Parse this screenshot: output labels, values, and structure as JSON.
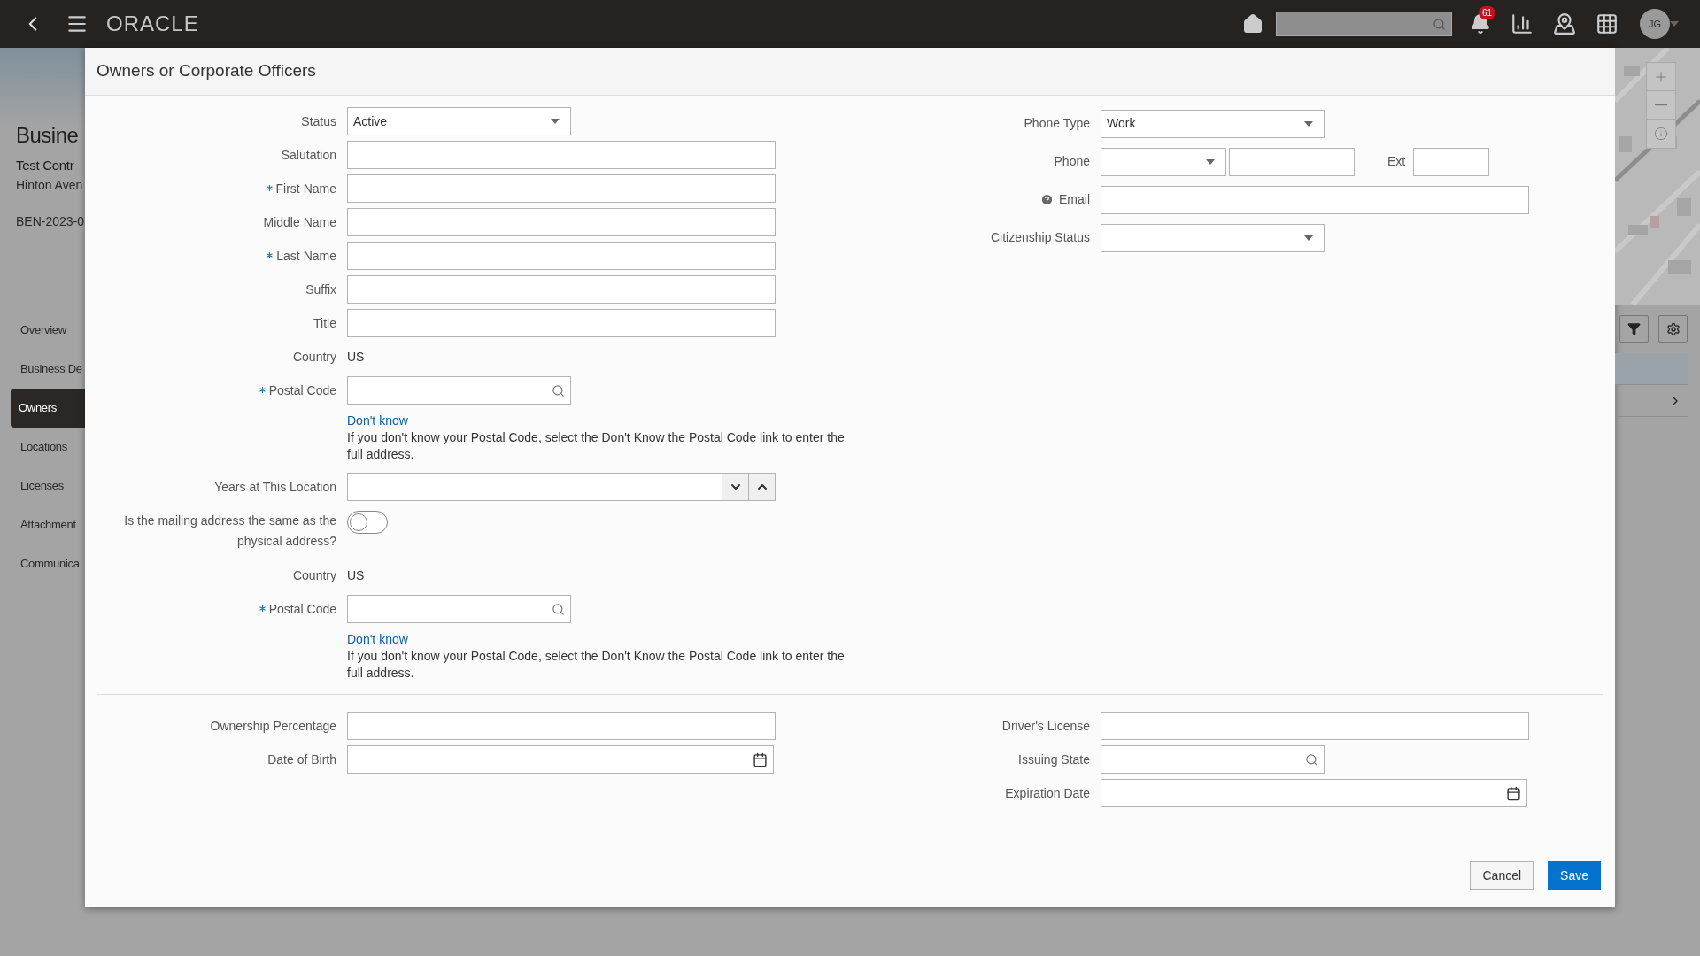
{
  "top_bar": {
    "brand": "ORACLE",
    "notification_count": "61",
    "avatar_initials": "JG"
  },
  "background": {
    "page_title": "Busine",
    "record_name": "Test Contr",
    "address": "Hinton Aven",
    "record_id": "BEN-2023-0",
    "nav_items": [
      {
        "label": "Overview",
        "selected": false
      },
      {
        "label": "Business De",
        "selected": false
      },
      {
        "label": "Owners",
        "selected": true
      },
      {
        "label": "Locations",
        "selected": false
      },
      {
        "label": "Licenses",
        "selected": false
      },
      {
        "label": "Attachment",
        "selected": false
      },
      {
        "label": "Communica",
        "selected": false
      }
    ]
  },
  "dialog": {
    "title": "Owners or Corporate Officers",
    "left_fields": [
      {
        "kind": "select",
        "label": "Status",
        "required": false,
        "value": "Active"
      },
      {
        "kind": "text",
        "label": "Salutation",
        "required": false
      },
      {
        "kind": "text",
        "label": "First Name",
        "required": true
      },
      {
        "kind": "text",
        "label": "Middle Name",
        "required": false
      },
      {
        "kind": "text",
        "label": "Last Name",
        "required": true
      },
      {
        "kind": "text",
        "label": "Suffix",
        "required": false
      },
      {
        "kind": "text",
        "label": "Title",
        "required": false
      },
      {
        "kind": "readonly",
        "label": "Country",
        "required": false,
        "value": "US"
      },
      {
        "kind": "lookup",
        "label": "Postal Code",
        "required": true
      },
      {
        "kind": "help",
        "link": "Don't know",
        "text": "If you don't know your Postal Code, select the Don't Know the Postal Code link to enter the full address."
      },
      {
        "kind": "spinner",
        "label": "Years at This Location",
        "required": false
      },
      {
        "kind": "toggle",
        "label": "Is the mailing address the same as the physical address?",
        "required": false,
        "on": false
      },
      {
        "kind": "readonly",
        "label": "Country",
        "required": false,
        "value": "US"
      },
      {
        "kind": "lookup",
        "label": "Postal Code",
        "required": true
      },
      {
        "kind": "help",
        "link": "Don't know",
        "text": "If you don't know your Postal Code, select the Don't Know the Postal Code link to enter the full address."
      }
    ],
    "right_fields": [
      {
        "kind": "select",
        "label": "Phone Type",
        "required": false,
        "value": "Work"
      },
      {
        "kind": "phone",
        "label": "Phone",
        "required": false,
        "ext_label": "Ext"
      },
      {
        "kind": "text_with_help",
        "label": "Email",
        "required": false
      },
      {
        "kind": "select",
        "label": "Citizenship Status",
        "required": false
      }
    ],
    "lower_left_fields": [
      {
        "kind": "text",
        "label": "Ownership Percentage",
        "required": false
      },
      {
        "kind": "date",
        "label": "Date of Birth",
        "required": false
      }
    ],
    "lower_right_fields": [
      {
        "kind": "text",
        "label": "Driver's License",
        "required": false
      },
      {
        "kind": "lookup",
        "label": "Issuing State",
        "required": false
      },
      {
        "kind": "date",
        "label": "Expiration Date",
        "required": false
      }
    ],
    "buttons": [
      {
        "label": "Cancel",
        "kind": "secondary"
      },
      {
        "label": "Save",
        "kind": "primary"
      }
    ]
  }
}
